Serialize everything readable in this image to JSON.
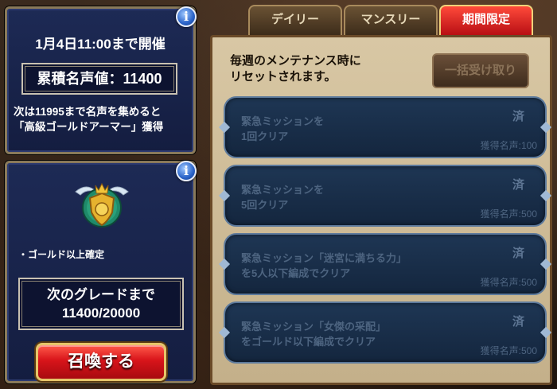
{
  "event_panel": {
    "title": "1月4日11:00まで開催",
    "fame_value": "累積名声値：11400",
    "next_reward_line1": "次は11995まで名声を集めると",
    "next_reward_line2": "「高級ゴールドアーマー」獲得"
  },
  "summon_panel": {
    "bullet": "・ゴールド以上確定",
    "grade_line1": "次のグレードまで",
    "grade_line2": "11400/20000",
    "summon_label": "召喚する"
  },
  "tabs": [
    {
      "label": "デイリー"
    },
    {
      "label": "マンスリー"
    },
    {
      "label": "期間限定"
    }
  ],
  "main": {
    "reset_line1": "毎週のメンテナンス時に",
    "reset_line2": "リセットされます。",
    "claim_all_label": "一括受け取り",
    "missions": [
      {
        "line1": "緊急ミッションを",
        "line2": "1回クリア",
        "status": "済",
        "reward": "獲得名声:100"
      },
      {
        "line1": "緊急ミッションを",
        "line2": "5回クリア",
        "status": "済",
        "reward": "獲得名声:500"
      },
      {
        "line1": "緊急ミッション「迷宮に満ちる力」",
        "line2": "を5人以下編成でクリア",
        "status": "済",
        "reward": "獲得名声:500"
      },
      {
        "line1": "緊急ミッション「女傑の采配」",
        "line2": "をゴールド以下編成でクリア",
        "status": "済",
        "reward": "獲得名声:500"
      }
    ]
  }
}
